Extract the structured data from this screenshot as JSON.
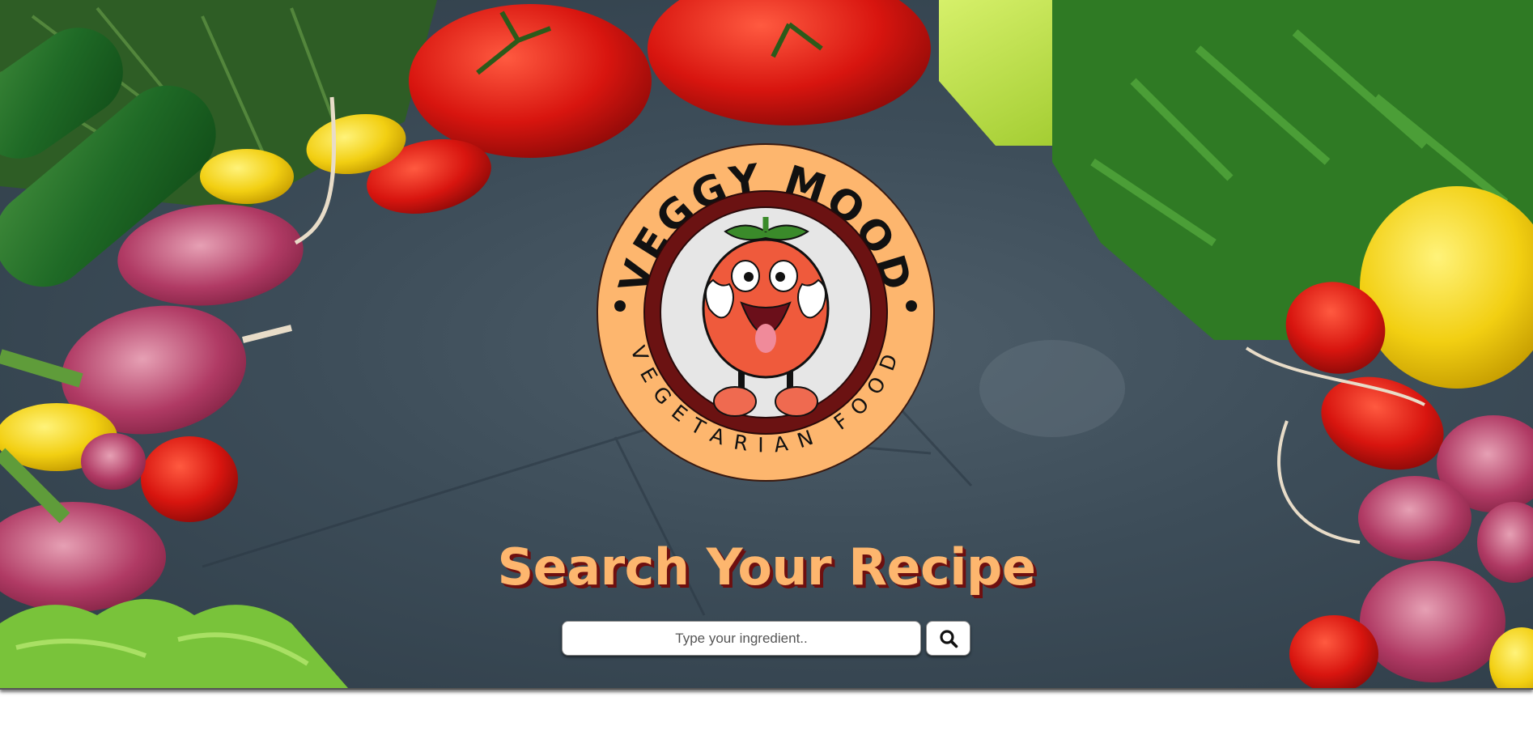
{
  "logo": {
    "top_text": "VEGGY MOOD",
    "bottom_text": "VEGETARIAN FOOD"
  },
  "hero": {
    "title": "Search Your Recipe"
  },
  "search": {
    "placeholder": "Type your ingredient..",
    "value": "",
    "button_icon": "search-icon"
  },
  "colors": {
    "title": "#fdb66e",
    "title_shadow": "#6e0f0f",
    "logo_ring": "#fdb66e",
    "logo_inner_ring": "#6b1212",
    "background_slate": "#3d4d59"
  }
}
